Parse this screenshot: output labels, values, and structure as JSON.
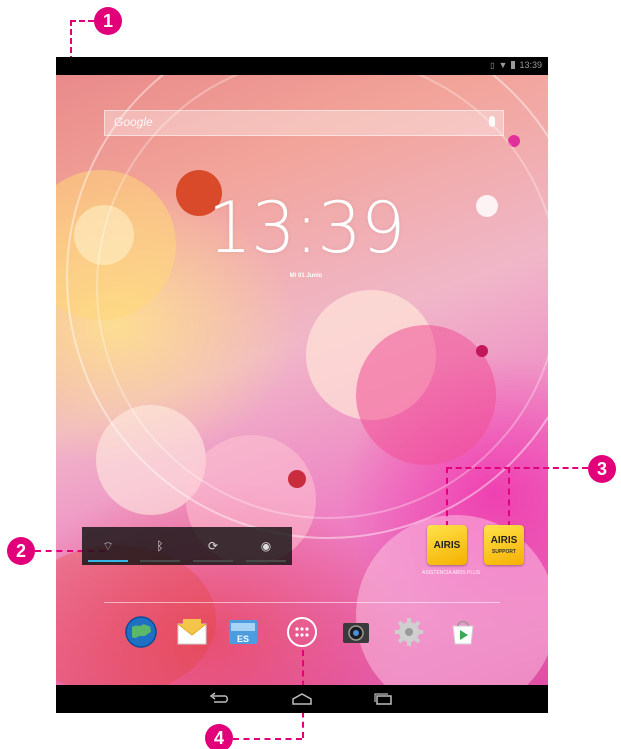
{
  "status_bar": {
    "time": "13:39"
  },
  "home": {
    "search": {
      "label": "Google",
      "mic_icon": "mic-icon"
    },
    "clock": {
      "time": "13:39",
      "date": "Mi 01 Junio"
    },
    "power_widget": {
      "toggles": [
        {
          "icon": "wifi-icon",
          "glyph": "⌔"
        },
        {
          "icon": "bluetooth-icon",
          "glyph": "ᛒ"
        },
        {
          "icon": "sync-icon",
          "glyph": "⟳"
        },
        {
          "icon": "brightness-icon",
          "glyph": "◉"
        }
      ]
    },
    "app_widgets": [
      {
        "brand": "AIRIS",
        "sub": ""
      },
      {
        "brand": "AIRIS",
        "sub": "SUPPORT"
      }
    ],
    "app_widgets_label": "ASISTENCIA AIRIS PLUS",
    "dock": [
      {
        "icon": "browser-globe-icon"
      },
      {
        "icon": "email-icon"
      },
      {
        "icon": "file-explorer-icon"
      },
      {
        "icon": "app-drawer-icon"
      },
      {
        "icon": "camera-icon"
      },
      {
        "icon": "settings-gear-icon"
      },
      {
        "icon": "play-store-icon"
      }
    ]
  },
  "nav_bar": {
    "back": "back-icon",
    "home": "home-icon",
    "recents": "recents-icon"
  },
  "callouts": [
    "1",
    "2",
    "3",
    "4"
  ],
  "colors": {
    "callout": "#e2007a",
    "toggle_on": "#33b5e5"
  }
}
